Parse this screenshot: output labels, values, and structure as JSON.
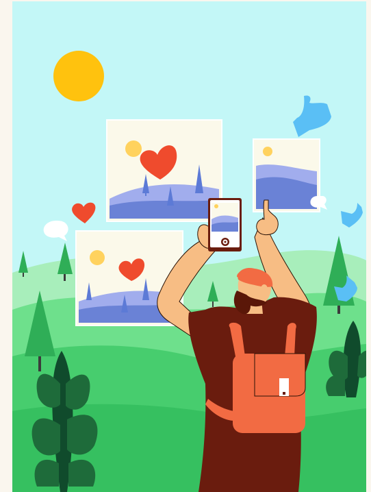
{
  "colors": {
    "page_bg": "#faf6ee",
    "sky": "#c3f7f7",
    "sun": "#ffc20e",
    "hill_far": "#a8eebb",
    "hill_mid": "#6ee08c",
    "hill_near": "#47cd6e",
    "ground": "#36c060",
    "tree": "#2fae57",
    "tree_dark": "#1e6b3a",
    "plant_dark": "#104b2c",
    "trunk": "#3b3b3b",
    "photo_bg": "#fbf9ea",
    "photo_sun": "#ffd25e",
    "photo_hill_light": "#a1aded",
    "photo_hill_dark": "#6a82d6",
    "photo_tree": "#5c7ad6",
    "heart": "#ef4b2d",
    "thumbs": "#5abff5",
    "bubble": "#ffffff",
    "skin": "#f7bd84",
    "shirt": "#6a1c0e",
    "cap": "#f26b43",
    "backpack": "#f26b43",
    "beard": "#5a1708",
    "phone_body": "#6a1c0e",
    "outline": "#2a1205"
  },
  "illustration": {
    "scene": "man-photographing-landscape",
    "icons": [
      "sun-icon",
      "heart-icon",
      "thumbs-up-icon",
      "speech-bubble-icon",
      "camera-phone-icon",
      "backpack-icon"
    ]
  }
}
